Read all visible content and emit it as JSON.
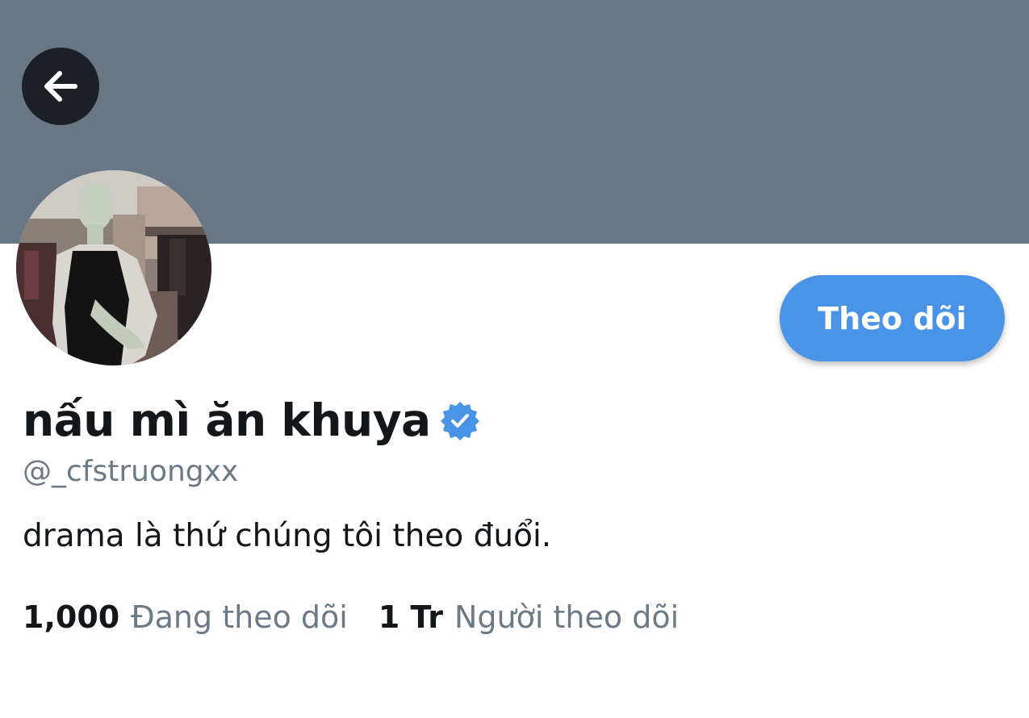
{
  "header": {
    "banner_color": "#687785",
    "back_icon": "arrow-left-icon"
  },
  "profile": {
    "display_name": "nấu mì ăn khuya",
    "verified_icon": "verified-badge-icon",
    "handle": "@_cfstruongxx",
    "bio": "drama là thứ chúng tôi theo đuổi.",
    "follow_button_label": "Theo dõi",
    "accent_color": "#4a94e8"
  },
  "stats": {
    "following_count": "1,000",
    "following_label": "Đang theo dõi",
    "followers_count": "1 Tr",
    "followers_label": "Người theo dõi"
  }
}
